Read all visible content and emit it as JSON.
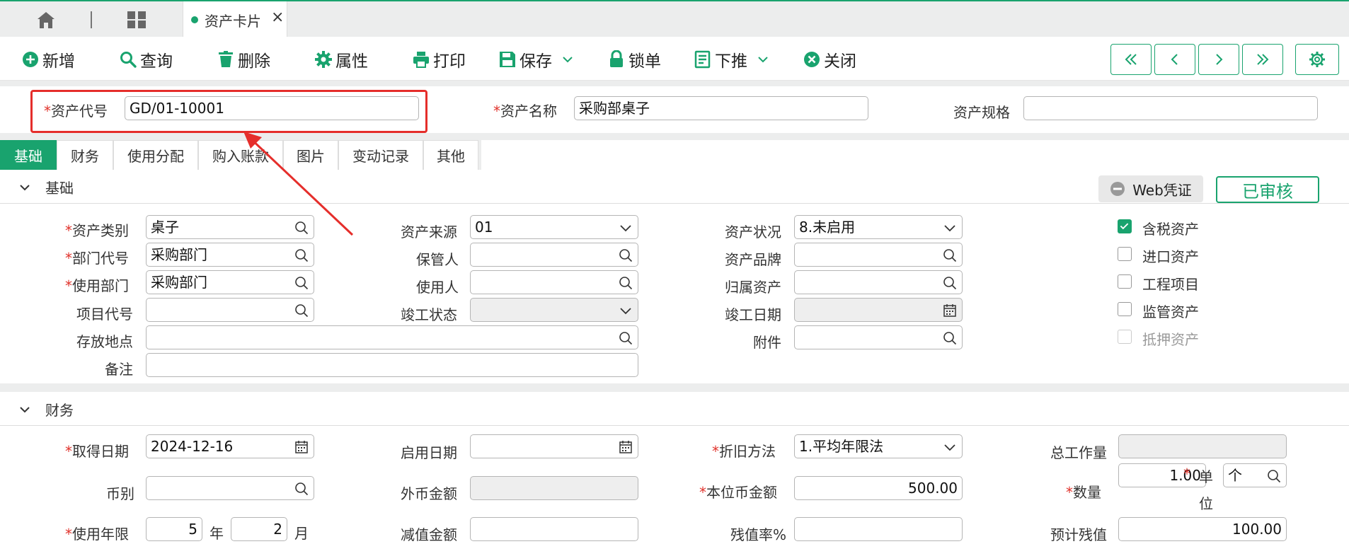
{
  "doc_tab": {
    "title": "资产卡片"
  },
  "toolbar": {
    "add": "新增",
    "query": "查询",
    "delete": "删除",
    "attributes": "属性",
    "print": "打印",
    "save": "保存",
    "lock": "锁单",
    "push_down": "下推",
    "close": "关闭"
  },
  "header": {
    "asset_code_label": "资产代号",
    "asset_code": "GD/01-10001",
    "asset_name_label": "资产名称",
    "asset_name": "采购部桌子",
    "asset_spec_label": "资产规格",
    "asset_spec": ""
  },
  "tabs": [
    "基础",
    "财务",
    "使用分配",
    "购入账款",
    "图片",
    "变动记录",
    "其他"
  ],
  "basic": {
    "title": "基础",
    "web_voucher": "Web凭证",
    "status": "已审核",
    "category_label": "资产类别",
    "category": "桌子",
    "dept_code_label": "部门代号",
    "dept_code": "采购部门",
    "use_dept_label": "使用部门",
    "use_dept": "采购部门",
    "project_label": "项目代号",
    "project": "",
    "location_label": "存放地点",
    "location": "",
    "remark_label": "备注",
    "remark": "",
    "source_label": "资产来源",
    "source": "01",
    "keeper_label": "保管人",
    "keeper": "",
    "user_label": "使用人",
    "user": "",
    "completion_status_label": "竣工状态",
    "completion_status": "",
    "asset_state_label": "资产状况",
    "asset_state": "8.未启用",
    "brand_label": "资产品牌",
    "brand": "",
    "belong_label": "归属资产",
    "belong": "",
    "completion_date_label": "竣工日期",
    "completion_date": "",
    "attachment_label": "附件",
    "attachment": "",
    "checks": [
      {
        "label": "含税资产",
        "checked": true
      },
      {
        "label": "进口资产",
        "checked": false
      },
      {
        "label": "工程项目",
        "checked": false
      },
      {
        "label": "监管资产",
        "checked": false
      },
      {
        "label": "抵押资产",
        "checked": false,
        "disabled": true
      }
    ]
  },
  "finance": {
    "title": "财务",
    "acquire_date_label": "取得日期",
    "acquire_date": "2024-12-16",
    "currency_label": "币别",
    "currency": "",
    "life_label": "使用年限",
    "life_years": "5",
    "year_unit": "年",
    "life_months": "2",
    "month_unit": "月",
    "start_date_label": "启用日期",
    "start_date": "",
    "foreign_amount_label": "外币金额",
    "foreign_amount": "",
    "impairment_label": "减值金额",
    "impairment": "",
    "depr_method_label": "折旧方法",
    "depr_method": "1.平均年限法",
    "local_amount_label": "本位币金额",
    "local_amount": "500.00",
    "residual_rate_label": "残值率%",
    "residual_rate": "",
    "total_work_label": "总工作量",
    "total_work": "",
    "quantity_label": "数量",
    "quantity": "1.00",
    "unit_label_1": "单",
    "unit_label_2": "位",
    "unit": "个",
    "est_residual_label": "预计残值",
    "est_residual": "100.00"
  },
  "colors": {
    "accent": "#19a36e",
    "required": "#e0322b",
    "highlight": "#e52e2b"
  }
}
